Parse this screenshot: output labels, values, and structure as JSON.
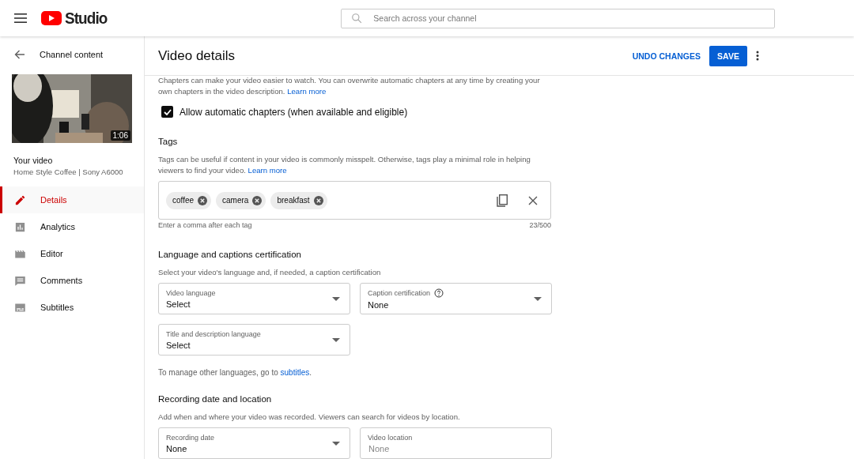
{
  "header": {
    "logo_text": "Studio",
    "search": {
      "placeholder": "Search across your channel"
    }
  },
  "sidebar": {
    "back_label": "Channel content",
    "thumbnail": {
      "kind": "picture",
      "duration": "1:06"
    },
    "video_heading": "Your video",
    "video_title": "Home Style Coffee | Sony A6000",
    "items": [
      {
        "label": "Details",
        "kind": "pencil",
        "selected": true
      },
      {
        "label": "Analytics",
        "kind": "chart",
        "selected": false
      },
      {
        "label": "Editor",
        "kind": "clapper",
        "selected": false
      },
      {
        "label": "Comments",
        "kind": "comment",
        "selected": false
      },
      {
        "label": "Subtitles",
        "kind": "subtitles",
        "selected": false
      }
    ]
  },
  "main": {
    "title": "Video details",
    "undo_label": "UNDO CHANGES",
    "save_label": "SAVE",
    "chapters": {
      "description": "Chapters can make your video easier to watch. You can overwrite automatic chapters at any time by creating your own chapters in the video description.",
      "link": "Learn more",
      "checkbox": {
        "label": "Allow automatic chapters (when available and eligible)",
        "checked": true
      }
    },
    "tags": {
      "heading": "Tags",
      "description": "Tags can be useful if content in your video is commonly misspelt. Otherwise, tags play a minimal role in helping viewers to find your video.",
      "link": "Learn more",
      "chips": [
        "coffee",
        "camera",
        "breakfast"
      ],
      "helper": "Enter a comma after each tag",
      "count": "23/500"
    },
    "language": {
      "heading": "Language and captions certification",
      "description": "Select your video's language and, if needed, a caption certification",
      "fields": [
        {
          "kind": "select",
          "label": "Video language",
          "value": "Select"
        },
        {
          "kind": "select",
          "label": "Caption certification",
          "value": "None",
          "help": true
        },
        {
          "kind": "select",
          "label": "Title and description language",
          "value": "Select"
        }
      ],
      "note": "To manage other languages, go to",
      "note_link": "subtitles",
      "note_end": "."
    },
    "recording": {
      "heading": "Recording date and location",
      "description": "Add when and where your video was recorded. Viewers can search for videos by location.",
      "fields": [
        {
          "kind": "select",
          "label": "Recording date",
          "value": "None"
        },
        {
          "kind": "text",
          "label": "Video location",
          "placeholder": "None"
        }
      ]
    }
  }
}
